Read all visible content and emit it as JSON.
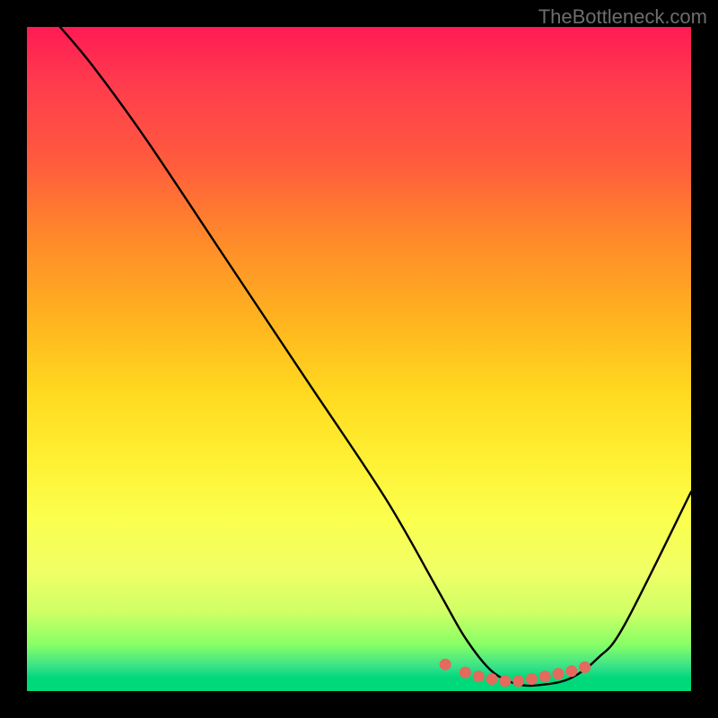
{
  "watermark": "TheBottleneck.com",
  "chart_data": {
    "type": "line",
    "title": "",
    "xlabel": "",
    "ylabel": "",
    "xlim": [
      0,
      100
    ],
    "ylim": [
      0,
      100
    ],
    "grid": false,
    "series": [
      {
        "name": "bottleneck-curve",
        "x": [
          5,
          10,
          18,
          30,
          42,
          54,
          62,
          66,
          70,
          74,
          78,
          82,
          86,
          90,
          100
        ],
        "y": [
          100,
          94,
          83,
          65,
          47,
          29,
          15,
          8,
          3,
          1,
          1,
          2,
          5,
          10,
          30
        ]
      }
    ],
    "markers": {
      "name": "optimal-range-dots",
      "color": "#e36a5c",
      "points": [
        {
          "x": 63,
          "y": 4.0
        },
        {
          "x": 66,
          "y": 2.8
        },
        {
          "x": 68,
          "y": 2.2
        },
        {
          "x": 70,
          "y": 1.8
        },
        {
          "x": 72,
          "y": 1.5
        },
        {
          "x": 74,
          "y": 1.5
        },
        {
          "x": 76,
          "y": 1.8
        },
        {
          "x": 78,
          "y": 2.2
        },
        {
          "x": 80,
          "y": 2.6
        },
        {
          "x": 82,
          "y": 3.0
        },
        {
          "x": 84,
          "y": 3.6
        }
      ]
    }
  }
}
